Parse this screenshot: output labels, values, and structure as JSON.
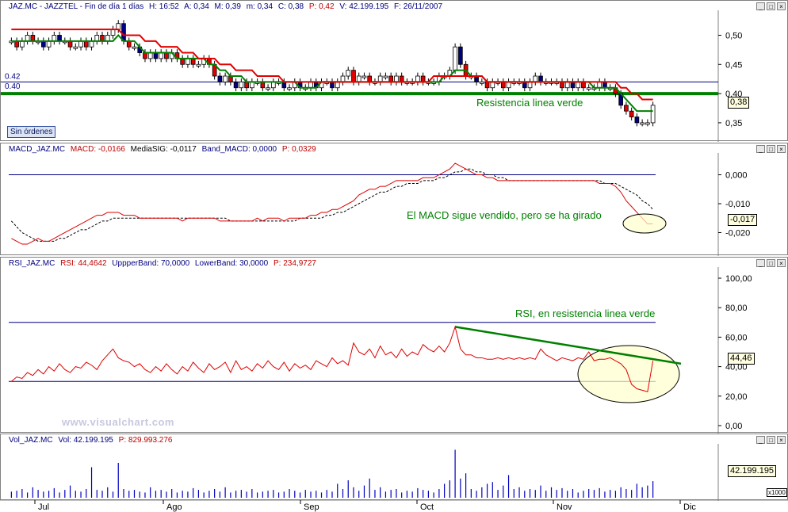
{
  "panels": {
    "price": {
      "title_parts": [
        "JAZ.MC - JAZZTEL - Fin de día 1 días",
        "H: 16:52",
        "A: 0,34",
        "M: 0,39",
        "m: 0,34",
        "C: 0,38",
        "P: 0,42",
        "V: 42.199.195",
        "F: 26/11/2007"
      ],
      "level_labels": [
        "0.42",
        "0.40"
      ],
      "badge": "Sin órdenes",
      "annotation": "Resistencia linea verde",
      "last_value": "0,38",
      "yticks": [
        "0,50",
        "0,45",
        "0,40",
        "0,35"
      ]
    },
    "macd": {
      "title_parts": [
        "MACD_JAZ.MC",
        "MACD: -0,0166",
        "MediaSIG: -0,0117",
        "Band_MACD: 0,0000",
        "P: 0,0329"
      ],
      "annotation": "El MACD sigue vendido, pero se ha girado",
      "last_value": "-0,017",
      "yticks": [
        "0,000",
        "-0,010",
        "-0,020"
      ]
    },
    "rsi": {
      "title_parts": [
        "RSI_JAZ.MC",
        "RSI: 44,4642",
        "UppperBand: 70,0000",
        "LowerBand: 30,0000",
        "P: 234,9727"
      ],
      "annotation": "RSI, en resistencia linea verde",
      "last_value": "44,46",
      "yticks": [
        "100,00",
        "80,00",
        "60,00",
        "40,00",
        "20,00",
        "0,00"
      ]
    },
    "volume": {
      "title_parts": [
        "Vol_JAZ.MC",
        "Vol: 42.199.195",
        "P: 829.993.276"
      ],
      "last_value": "42.199.195",
      "multiplier": "x1000"
    }
  },
  "months": [
    "Jul",
    "Ago",
    "Sep",
    "Oct",
    "Nov",
    "Dic"
  ],
  "watermark": "www.visualchart.com",
  "colors": {
    "up": "#ffffff",
    "down": "#e00000",
    "navy": "#000080",
    "green": "#008000",
    "red": "#e00000"
  },
  "chart_data": [
    {
      "type": "candlestick",
      "ylim": [
        0.32,
        0.54
      ],
      "levels": [
        0.42,
        0.4
      ],
      "close": [
        0.49,
        0.48,
        0.49,
        0.5,
        0.49,
        0.49,
        0.48,
        0.49,
        0.5,
        0.49,
        0.49,
        0.48,
        0.48,
        0.49,
        0.48,
        0.49,
        0.5,
        0.49,
        0.5,
        0.51,
        0.52,
        0.49,
        0.48,
        0.48,
        0.47,
        0.46,
        0.47,
        0.46,
        0.47,
        0.46,
        0.47,
        0.46,
        0.45,
        0.46,
        0.45,
        0.45,
        0.46,
        0.45,
        0.43,
        0.42,
        0.43,
        0.42,
        0.41,
        0.42,
        0.41,
        0.42,
        0.42,
        0.41,
        0.41,
        0.42,
        0.42,
        0.41,
        0.41,
        0.42,
        0.41,
        0.41,
        0.42,
        0.41,
        0.42,
        0.42,
        0.41,
        0.42,
        0.43,
        0.44,
        0.42,
        0.43,
        0.43,
        0.42,
        0.42,
        0.43,
        0.43,
        0.42,
        0.43,
        0.42,
        0.42,
        0.42,
        0.43,
        0.42,
        0.42,
        0.42,
        0.43,
        0.43,
        0.44,
        0.48,
        0.45,
        0.43,
        0.43,
        0.42,
        0.42,
        0.41,
        0.42,
        0.42,
        0.41,
        0.42,
        0.42,
        0.42,
        0.41,
        0.42,
        0.43,
        0.42,
        0.42,
        0.42,
        0.42,
        0.41,
        0.42,
        0.41,
        0.42,
        0.41,
        0.41,
        0.41,
        0.42,
        0.41,
        0.41,
        0.4,
        0.38,
        0.37,
        0.36,
        0.35,
        0.35,
        0.35,
        0.38
      ],
      "series": [
        {
          "name": "",
          "color": "#008000",
          "values": [
            0.49,
            0.49,
            0.49,
            0.49,
            0.49,
            0.49,
            0.49,
            0.49,
            0.49,
            0.49,
            0.49,
            0.49,
            0.49,
            0.49,
            0.49,
            0.49,
            0.49,
            0.49,
            0.49,
            0.49,
            0.5,
            0.49,
            0.49,
            0.49,
            0.48,
            0.47,
            0.47,
            0.47,
            0.47,
            0.47,
            0.47,
            0.46,
            0.46,
            0.46,
            0.46,
            0.46,
            0.46,
            0.45,
            0.45,
            0.44,
            0.44,
            0.43,
            0.43,
            0.43,
            0.42,
            0.42,
            0.42,
            0.42,
            0.42,
            0.42,
            0.42,
            0.42,
            0.42,
            0.42,
            0.41,
            0.41,
            0.41,
            0.41,
            0.42,
            0.42,
            0.42,
            0.42,
            0.42,
            0.42,
            0.42,
            0.42,
            0.42,
            0.42,
            0.42,
            0.42,
            0.42,
            0.42,
            0.42,
            0.42,
            0.42,
            0.42,
            0.42,
            0.42,
            0.42,
            0.42,
            0.42,
            0.43,
            0.43,
            0.44,
            0.44,
            0.44,
            0.43,
            0.43,
            0.43,
            0.42,
            0.42,
            0.42,
            0.42,
            0.42,
            0.42,
            0.42,
            0.42,
            0.42,
            0.42,
            0.42,
            0.42,
            0.42,
            0.42,
            0.42,
            0.42,
            0.42,
            0.42,
            0.42,
            0.42,
            0.41,
            0.41,
            0.41,
            0.41,
            0.41,
            0.4,
            0.39,
            0.38,
            0.37,
            0.37,
            0.37,
            0.37
          ]
        },
        {
          "name": "",
          "color": "#e00000",
          "values": [
            0.51,
            0.51,
            0.51,
            0.51,
            0.51,
            0.51,
            0.51,
            0.51,
            0.51,
            0.51,
            0.51,
            0.51,
            0.51,
            0.51,
            0.51,
            0.51,
            0.51,
            0.51,
            0.51,
            0.51,
            0.51,
            0.5,
            0.5,
            0.5,
            0.5,
            0.49,
            0.49,
            0.49,
            0.48,
            0.48,
            0.48,
            0.48,
            0.47,
            0.47,
            0.47,
            0.46,
            0.46,
            0.46,
            0.46,
            0.45,
            0.45,
            0.45,
            0.44,
            0.44,
            0.44,
            0.44,
            0.43,
            0.43,
            0.43,
            0.43,
            0.43,
            0.42,
            0.42,
            0.42,
            0.42,
            0.42,
            0.42,
            0.42,
            0.42,
            0.42,
            0.42,
            0.42,
            0.42,
            0.42,
            0.42,
            0.42,
            0.42,
            0.42,
            0.42,
            0.42,
            0.42,
            0.42,
            0.42,
            0.42,
            0.42,
            0.42,
            0.42,
            0.42,
            0.42,
            0.43,
            0.43,
            0.43,
            0.43,
            0.43,
            0.43,
            0.43,
            0.43,
            0.43,
            0.43,
            0.42,
            0.42,
            0.42,
            0.42,
            0.42,
            0.42,
            0.42,
            0.42,
            0.42,
            0.42,
            0.42,
            0.42,
            0.42,
            0.42,
            0.42,
            0.42,
            0.42,
            0.42,
            0.42,
            0.42,
            0.42,
            0.42,
            0.42,
            0.42,
            0.42,
            0.41,
            0.41,
            0.4,
            0.4,
            0.39,
            0.39,
            0.39
          ]
        }
      ]
    },
    {
      "type": "line",
      "ylim": [
        -0.027,
        0.007
      ],
      "levels": [
        0.0
      ],
      "series": [
        {
          "name": "MACD",
          "color": "#e00000",
          "values": [
            -0.022,
            -0.023,
            -0.024,
            -0.024,
            -0.023,
            -0.022,
            -0.023,
            -0.023,
            -0.022,
            -0.021,
            -0.02,
            -0.019,
            -0.018,
            -0.017,
            -0.016,
            -0.015,
            -0.014,
            -0.014,
            -0.013,
            -0.013,
            -0.013,
            -0.014,
            -0.014,
            -0.014,
            -0.015,
            -0.015,
            -0.015,
            -0.015,
            -0.015,
            -0.015,
            -0.015,
            -0.015,
            -0.016,
            -0.015,
            -0.015,
            -0.015,
            -0.015,
            -0.015,
            -0.015,
            -0.016,
            -0.016,
            -0.016,
            -0.016,
            -0.016,
            -0.016,
            -0.016,
            -0.015,
            -0.016,
            -0.015,
            -0.015,
            -0.015,
            -0.016,
            -0.015,
            -0.015,
            -0.015,
            -0.015,
            -0.014,
            -0.014,
            -0.013,
            -0.013,
            -0.012,
            -0.012,
            -0.011,
            -0.01,
            -0.009,
            -0.007,
            -0.006,
            -0.005,
            -0.005,
            -0.004,
            -0.004,
            -0.003,
            -0.002,
            -0.002,
            -0.002,
            -0.002,
            -0.002,
            -0.001,
            -0.001,
            -0.001,
            0.0,
            0.001,
            0.002,
            0.004,
            0.003,
            0.002,
            0.001,
            0.0,
            0.0,
            -0.001,
            -0.001,
            -0.002,
            -0.002,
            -0.002,
            -0.002,
            -0.002,
            -0.002,
            -0.002,
            -0.002,
            -0.002,
            -0.002,
            -0.002,
            -0.002,
            -0.002,
            -0.002,
            -0.002,
            -0.002,
            -0.002,
            -0.002,
            -0.002,
            -0.003,
            -0.003,
            -0.003,
            -0.004,
            -0.006,
            -0.009,
            -0.011,
            -0.013,
            -0.015,
            -0.017,
            -0.017
          ]
        },
        {
          "name": "MediaSIG",
          "color": "#000000",
          "values": [
            -0.016,
            -0.018,
            -0.02,
            -0.021,
            -0.022,
            -0.023,
            -0.023,
            -0.023,
            -0.023,
            -0.022,
            -0.022,
            -0.021,
            -0.02,
            -0.019,
            -0.019,
            -0.018,
            -0.017,
            -0.016,
            -0.016,
            -0.015,
            -0.015,
            -0.015,
            -0.015,
            -0.015,
            -0.015,
            -0.015,
            -0.015,
            -0.015,
            -0.015,
            -0.015,
            -0.015,
            -0.015,
            -0.015,
            -0.015,
            -0.015,
            -0.015,
            -0.015,
            -0.015,
            -0.015,
            -0.015,
            -0.015,
            -0.016,
            -0.016,
            -0.016,
            -0.016,
            -0.016,
            -0.016,
            -0.016,
            -0.016,
            -0.016,
            -0.016,
            -0.016,
            -0.016,
            -0.016,
            -0.015,
            -0.015,
            -0.015,
            -0.015,
            -0.015,
            -0.014,
            -0.014,
            -0.013,
            -0.013,
            -0.012,
            -0.011,
            -0.01,
            -0.009,
            -0.008,
            -0.007,
            -0.006,
            -0.006,
            -0.005,
            -0.004,
            -0.004,
            -0.003,
            -0.003,
            -0.003,
            -0.002,
            -0.002,
            -0.002,
            -0.001,
            -0.001,
            0.0,
            0.001,
            0.001,
            0.002,
            0.002,
            0.001,
            0.001,
            0.0,
            0.0,
            -0.001,
            -0.001,
            -0.002,
            -0.002,
            -0.002,
            -0.002,
            -0.002,
            -0.002,
            -0.002,
            -0.002,
            -0.002,
            -0.002,
            -0.002,
            -0.002,
            -0.002,
            -0.002,
            -0.002,
            -0.002,
            -0.002,
            -0.002,
            -0.003,
            -0.003,
            -0.003,
            -0.004,
            -0.005,
            -0.006,
            -0.007,
            -0.009,
            -0.01,
            -0.012
          ]
        }
      ]
    },
    {
      "type": "line",
      "ylim": [
        0,
        100
      ],
      "levels": [
        70,
        30
      ],
      "series": [
        {
          "name": "RSI",
          "color": "#e00000",
          "values": [
            30,
            33,
            32,
            36,
            34,
            38,
            35,
            40,
            37,
            42,
            38,
            36,
            40,
            39,
            43,
            41,
            38,
            44,
            48,
            52,
            46,
            44,
            43,
            40,
            42,
            38,
            36,
            40,
            37,
            42,
            38,
            35,
            40,
            37,
            43,
            39,
            36,
            42,
            38,
            40,
            43,
            36,
            44,
            38,
            40,
            37,
            42,
            39,
            44,
            40,
            38,
            43,
            37,
            42,
            39,
            41,
            38,
            44,
            42,
            40,
            46,
            42,
            44,
            41,
            56,
            50,
            48,
            52,
            46,
            54,
            48,
            50,
            46,
            52,
            47,
            50,
            48,
            55,
            52,
            50,
            54,
            50,
            56,
            67,
            52,
            48,
            48,
            46,
            46,
            45,
            45,
            46,
            45,
            46,
            45,
            46,
            45,
            46,
            45,
            52,
            48,
            46,
            44,
            46,
            45,
            44,
            46,
            45,
            50,
            44,
            45,
            45,
            46,
            44,
            42,
            38,
            28,
            25,
            24,
            23,
            44
          ]
        }
      ]
    },
    {
      "type": "bar",
      "ylabel": "x1000",
      "values": [
        7,
        8,
        10,
        6,
        12,
        9,
        7,
        8,
        11,
        6,
        9,
        14,
        8,
        7,
        10,
        35,
        9,
        8,
        12,
        7,
        40,
        10,
        8,
        9,
        7,
        6,
        12,
        8,
        9,
        7,
        10,
        6,
        8,
        7,
        11,
        9,
        6,
        8,
        10,
        7,
        12,
        6,
        8,
        9,
        7,
        10,
        6,
        7,
        8,
        9,
        6,
        7,
        10,
        8,
        6,
        9,
        7,
        8,
        6,
        9,
        7,
        16,
        10,
        20,
        12,
        8,
        14,
        22,
        9,
        12,
        7,
        9,
        10,
        6,
        8,
        7,
        11,
        9,
        8,
        6,
        10,
        16,
        20,
        55,
        22,
        28,
        10,
        8,
        12,
        16,
        18,
        9,
        14,
        26,
        10,
        12,
        8,
        10,
        9,
        14,
        8,
        12,
        9,
        11,
        8,
        10,
        6,
        8,
        10,
        9,
        11,
        7,
        9,
        8,
        12,
        10,
        9,
        16,
        12,
        14,
        19
      ]
    }
  ]
}
